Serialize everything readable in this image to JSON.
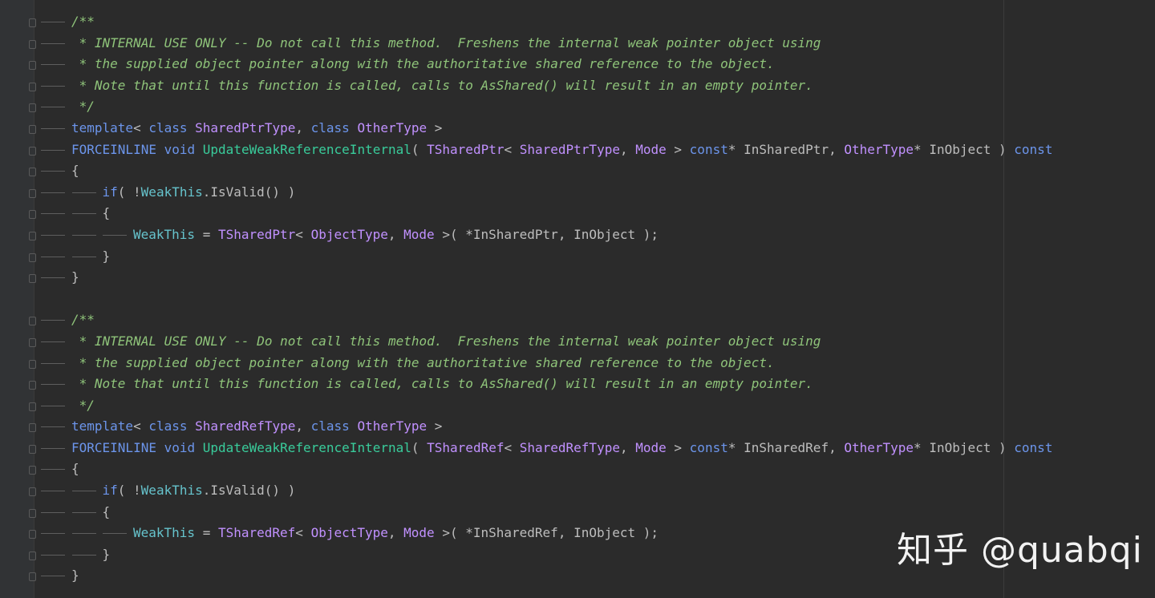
{
  "editor": {
    "lines": [
      {
        "indent": 0,
        "tokens": [
          {
            "t": "comment",
            "v": "/**"
          }
        ]
      },
      {
        "indent": 0,
        "tokens": [
          {
            "t": "comment",
            "v": " * INTERNAL USE ONLY -- Do not call this method.  Freshens the internal weak pointer object using"
          }
        ]
      },
      {
        "indent": 0,
        "tokens": [
          {
            "t": "comment",
            "v": " * the supplied object pointer along with the authoritative shared reference to the object."
          }
        ]
      },
      {
        "indent": 0,
        "tokens": [
          {
            "t": "comment",
            "v": " * Note that until this function is called, calls to AsShared() will result in an empty pointer."
          }
        ]
      },
      {
        "indent": 0,
        "tokens": [
          {
            "t": "comment",
            "v": " */"
          }
        ]
      },
      {
        "indent": 0,
        "tokens": [
          {
            "t": "kw",
            "v": "template"
          },
          {
            "t": "plain",
            "v": "< "
          },
          {
            "t": "kw",
            "v": "class"
          },
          {
            "t": "plain",
            "v": " "
          },
          {
            "t": "type",
            "v": "SharedPtrType"
          },
          {
            "t": "plain",
            "v": ", "
          },
          {
            "t": "kw",
            "v": "class"
          },
          {
            "t": "plain",
            "v": " "
          },
          {
            "t": "type",
            "v": "OtherType"
          },
          {
            "t": "plain",
            "v": " >"
          }
        ]
      },
      {
        "indent": 0,
        "tokens": [
          {
            "t": "kw",
            "v": "FORCEINLINE"
          },
          {
            "t": "plain",
            "v": " "
          },
          {
            "t": "kw",
            "v": "void"
          },
          {
            "t": "plain",
            "v": " "
          },
          {
            "t": "fn",
            "v": "UpdateWeakReferenceInternal"
          },
          {
            "t": "plain",
            "v": "( "
          },
          {
            "t": "type",
            "v": "TSharedPtr"
          },
          {
            "t": "plain",
            "v": "< "
          },
          {
            "t": "type",
            "v": "SharedPtrType"
          },
          {
            "t": "plain",
            "v": ", "
          },
          {
            "t": "type",
            "v": "Mode"
          },
          {
            "t": "plain",
            "v": " > "
          },
          {
            "t": "kw",
            "v": "const"
          },
          {
            "t": "plain",
            "v": "* InSharedPtr, "
          },
          {
            "t": "type",
            "v": "OtherType"
          },
          {
            "t": "plain",
            "v": "* InObject ) "
          },
          {
            "t": "kw",
            "v": "const"
          }
        ]
      },
      {
        "indent": 0,
        "tokens": [
          {
            "t": "plain",
            "v": "{"
          }
        ]
      },
      {
        "indent": 1,
        "tokens": [
          {
            "t": "kw",
            "v": "if"
          },
          {
            "t": "plain",
            "v": "( !"
          },
          {
            "t": "var",
            "v": "WeakThis"
          },
          {
            "t": "plain",
            "v": ".IsValid() )"
          }
        ]
      },
      {
        "indent": 1,
        "tokens": [
          {
            "t": "plain",
            "v": "{"
          }
        ]
      },
      {
        "indent": 2,
        "tokens": [
          {
            "t": "var",
            "v": "WeakThis"
          },
          {
            "t": "plain",
            "v": " = "
          },
          {
            "t": "type",
            "v": "TSharedPtr"
          },
          {
            "t": "plain",
            "v": "< "
          },
          {
            "t": "type",
            "v": "ObjectType"
          },
          {
            "t": "plain",
            "v": ", "
          },
          {
            "t": "type",
            "v": "Mode"
          },
          {
            "t": "plain",
            "v": " >( *InSharedPtr, InObject );"
          }
        ]
      },
      {
        "indent": 1,
        "tokens": [
          {
            "t": "plain",
            "v": "}"
          }
        ]
      },
      {
        "indent": 0,
        "tokens": [
          {
            "t": "plain",
            "v": "}"
          }
        ]
      },
      {
        "indent": -1,
        "tokens": []
      },
      {
        "indent": 0,
        "tokens": [
          {
            "t": "comment",
            "v": "/**"
          }
        ]
      },
      {
        "indent": 0,
        "tokens": [
          {
            "t": "comment",
            "v": " * INTERNAL USE ONLY -- Do not call this method.  Freshens the internal weak pointer object using"
          }
        ]
      },
      {
        "indent": 0,
        "tokens": [
          {
            "t": "comment",
            "v": " * the supplied object pointer along with the authoritative shared reference to the object."
          }
        ]
      },
      {
        "indent": 0,
        "tokens": [
          {
            "t": "comment",
            "v": " * Note that until this function is called, calls to AsShared() will result in an empty pointer."
          }
        ]
      },
      {
        "indent": 0,
        "tokens": [
          {
            "t": "comment",
            "v": " */"
          }
        ]
      },
      {
        "indent": 0,
        "tokens": [
          {
            "t": "kw",
            "v": "template"
          },
          {
            "t": "plain",
            "v": "< "
          },
          {
            "t": "kw",
            "v": "class"
          },
          {
            "t": "plain",
            "v": " "
          },
          {
            "t": "type",
            "v": "SharedRefType"
          },
          {
            "t": "plain",
            "v": ", "
          },
          {
            "t": "kw",
            "v": "class"
          },
          {
            "t": "plain",
            "v": " "
          },
          {
            "t": "type",
            "v": "OtherType"
          },
          {
            "t": "plain",
            "v": " >"
          }
        ]
      },
      {
        "indent": 0,
        "tokens": [
          {
            "t": "kw",
            "v": "FORCEINLINE"
          },
          {
            "t": "plain",
            "v": " "
          },
          {
            "t": "kw",
            "v": "void"
          },
          {
            "t": "plain",
            "v": " "
          },
          {
            "t": "fn",
            "v": "UpdateWeakReferenceInternal"
          },
          {
            "t": "plain",
            "v": "( "
          },
          {
            "t": "type",
            "v": "TSharedRef"
          },
          {
            "t": "plain",
            "v": "< "
          },
          {
            "t": "type",
            "v": "SharedRefType"
          },
          {
            "t": "plain",
            "v": ", "
          },
          {
            "t": "type",
            "v": "Mode"
          },
          {
            "t": "plain",
            "v": " > "
          },
          {
            "t": "kw",
            "v": "const"
          },
          {
            "t": "plain",
            "v": "* InSharedRef, "
          },
          {
            "t": "type",
            "v": "OtherType"
          },
          {
            "t": "plain",
            "v": "* InObject ) "
          },
          {
            "t": "kw",
            "v": "const"
          }
        ]
      },
      {
        "indent": 0,
        "tokens": [
          {
            "t": "plain",
            "v": "{"
          }
        ]
      },
      {
        "indent": 1,
        "tokens": [
          {
            "t": "kw",
            "v": "if"
          },
          {
            "t": "plain",
            "v": "( !"
          },
          {
            "t": "var",
            "v": "WeakThis"
          },
          {
            "t": "plain",
            "v": ".IsValid() )"
          }
        ]
      },
      {
        "indent": 1,
        "tokens": [
          {
            "t": "plain",
            "v": "{"
          }
        ]
      },
      {
        "indent": 2,
        "tokens": [
          {
            "t": "var",
            "v": "WeakThis"
          },
          {
            "t": "plain",
            "v": " = "
          },
          {
            "t": "type",
            "v": "TSharedRef"
          },
          {
            "t": "plain",
            "v": "< "
          },
          {
            "t": "type",
            "v": "ObjectType"
          },
          {
            "t": "plain",
            "v": ", "
          },
          {
            "t": "type",
            "v": "Mode"
          },
          {
            "t": "plain",
            "v": " >( *InSharedRef, InObject );"
          }
        ]
      },
      {
        "indent": 1,
        "tokens": [
          {
            "t": "plain",
            "v": "}"
          }
        ]
      },
      {
        "indent": 0,
        "tokens": [
          {
            "t": "plain",
            "v": "}"
          }
        ]
      }
    ]
  },
  "watermark": {
    "text": "知乎 @quabqi"
  },
  "colors": {
    "background": "#2b2b2b",
    "comment": "#8fc47a",
    "keyword": "#6c95eb",
    "type": "#c191ff",
    "function": "#39cc9b",
    "variable": "#66c3cc",
    "plain": "#bdbdbd"
  }
}
